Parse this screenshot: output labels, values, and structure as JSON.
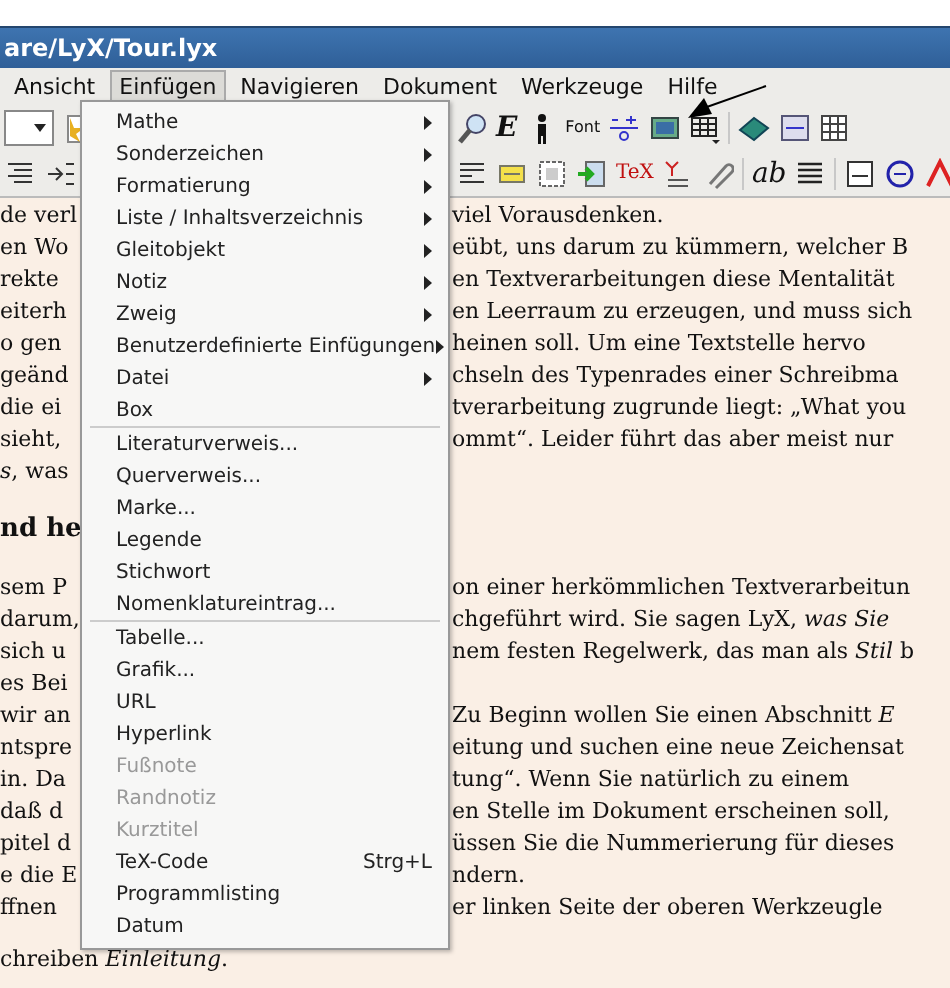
{
  "window": {
    "title": "are/LyX/Tour.lyx"
  },
  "menubar": [
    {
      "label": "Ansicht",
      "selected": false
    },
    {
      "label": "Einfügen",
      "selected": true
    },
    {
      "label": "Navigieren",
      "selected": false
    },
    {
      "label": "Dokument",
      "selected": false
    },
    {
      "label": "Werkzeuge",
      "selected": false
    },
    {
      "label": "Hilfe",
      "selected": false
    }
  ],
  "toolbars": [
    {
      "left": [
        {
          "kind": "combo"
        },
        {
          "kind": "icon"
        }
      ],
      "right": [
        {
          "kind": "icon"
        },
        {
          "kind": "glyph",
          "label": "E"
        },
        {
          "kind": "icon"
        },
        {
          "kind": "glyph",
          "label": "Font"
        },
        {
          "kind": "icon"
        },
        {
          "kind": "icon"
        },
        {
          "kind": "icon"
        },
        {
          "kind": "sep"
        },
        {
          "kind": "icon"
        },
        {
          "kind": "icon"
        },
        {
          "kind": "icon"
        }
      ]
    },
    {
      "left": [
        {
          "kind": "icon"
        },
        {
          "kind": "icon"
        }
      ],
      "right": [
        {
          "kind": "icon"
        },
        {
          "kind": "icon"
        },
        {
          "kind": "icon"
        },
        {
          "kind": "icon"
        },
        {
          "kind": "glyph",
          "label": "TeX"
        },
        {
          "kind": "icon"
        },
        {
          "kind": "icon"
        },
        {
          "kind": "sep"
        },
        {
          "kind": "glyph",
          "label": "ab"
        },
        {
          "kind": "icon"
        },
        {
          "kind": "sep"
        },
        {
          "kind": "icon"
        },
        {
          "kind": "icon"
        },
        {
          "kind": "icon"
        }
      ]
    }
  ],
  "menu": [
    {
      "kind": "submenu",
      "label": "Mathe"
    },
    {
      "kind": "submenu",
      "label": "Sonderzeichen"
    },
    {
      "kind": "submenu",
      "label": "Formatierung"
    },
    {
      "kind": "submenu",
      "label": "Liste / Inhaltsverzeichnis"
    },
    {
      "kind": "submenu",
      "label": "Gleitobjekt"
    },
    {
      "kind": "submenu",
      "label": "Notiz"
    },
    {
      "kind": "submenu",
      "label": "Zweig"
    },
    {
      "kind": "submenu",
      "label": "Benutzerdefinierte Einfügungen"
    },
    {
      "kind": "submenu",
      "label": "Datei"
    },
    {
      "kind": "item",
      "label": "Box",
      "disabled": false
    },
    {
      "kind": "separator"
    },
    {
      "kind": "item",
      "label": "Literaturverweis...",
      "disabled": false
    },
    {
      "kind": "item",
      "label": "Querverweis...",
      "disabled": false
    },
    {
      "kind": "item",
      "label": "Marke...",
      "disabled": false
    },
    {
      "kind": "item",
      "label": "Legende",
      "disabled": false
    },
    {
      "kind": "item",
      "label": "Stichwort",
      "disabled": false
    },
    {
      "kind": "item",
      "label": "Nomenklatureintrag...",
      "disabled": false
    },
    {
      "kind": "separator"
    },
    {
      "kind": "item",
      "label": "Tabelle...",
      "disabled": false
    },
    {
      "kind": "item",
      "label": "Grafik...",
      "disabled": false
    },
    {
      "kind": "item",
      "label": "URL",
      "disabled": false
    },
    {
      "kind": "item",
      "label": "Hyperlink",
      "disabled": false
    },
    {
      "kind": "item",
      "label": "Fußnote",
      "disabled": true
    },
    {
      "kind": "item",
      "label": "Randnotiz",
      "disabled": true
    },
    {
      "kind": "item",
      "label": "Kurztitel",
      "disabled": true
    },
    {
      "kind": "item",
      "label": "TeX-Code",
      "shortcut": "Strg+L",
      "disabled": false
    },
    {
      "kind": "item",
      "label": "Programmlisting",
      "disabled": false
    },
    {
      "kind": "item",
      "label": "Datum",
      "disabled": false
    }
  ],
  "document": [
    {
      "kind": "text",
      "left": "de verl",
      "right": "viel Vorausdenken."
    },
    {
      "kind": "text",
      "left": "en Wo",
      "right": "eübt, uns darum zu kümmern, welcher B"
    },
    {
      "kind": "text",
      "left": "rekte",
      "right": "en Textverarbeitungen diese Mentalität"
    },
    {
      "kind": "text",
      "left": "eiterh",
      "right": "en Leerraum zu erzeugen, und muss sich"
    },
    {
      "kind": "text",
      "left": "o gen",
      "right": "heinen soll. Um eine Textstelle hervo"
    },
    {
      "kind": "text",
      "left": "geänd",
      "right": "chseln des Typenrades einer Schreibma"
    },
    {
      "kind": "text",
      "left": "die ei",
      "right": "tverarbeitung zugrunde liegt: „What you"
    },
    {
      "kind": "text",
      "left": "sieht,",
      "right": "ommt“. Leider führt das aber meist nur"
    },
    {
      "kind": "text",
      "left": "*s*, was"
    },
    {
      "kind": "heading",
      "left": "nd he"
    },
    {
      "kind": "text",
      "left": "sem P",
      "right": "on einer herkömmlichen Textverarbeitun"
    },
    {
      "kind": "text",
      "left": "darum,",
      "right": "chgeführt wird. Sie sagen LyX, *was Sie*"
    },
    {
      "kind": "text",
      "left": "sich u",
      "right": "nem festen Regelwerk, das man als *Stil* b"
    },
    {
      "kind": "text",
      "left": "es Bei"
    },
    {
      "kind": "text",
      "left": "wir an",
      "right": "Zu Beginn wollen Sie einen Abschnitt *E*"
    },
    {
      "kind": "text",
      "left": "ntspre",
      "right": "eitung und suchen eine neue Zeichensat"
    },
    {
      "kind": "text",
      "left": "in. Da",
      "right": "tung“. Wenn Sie natürlich zu einem"
    },
    {
      "kind": "text",
      "left": "daß d",
      "right": "en Stelle im Dokument erscheinen soll,"
    },
    {
      "kind": "text",
      "left": "pitel d",
      "right": "üssen Sie die Nummerierung für dieses"
    },
    {
      "kind": "text",
      "left": "e die E",
      "right": "ndern."
    },
    {
      "kind": "text",
      "left": "ffnen",
      "right": "er linken Seite der oberen Werkzeugle"
    },
    {
      "kind": "full",
      "left": "chreiben *Einleitung*."
    }
  ]
}
